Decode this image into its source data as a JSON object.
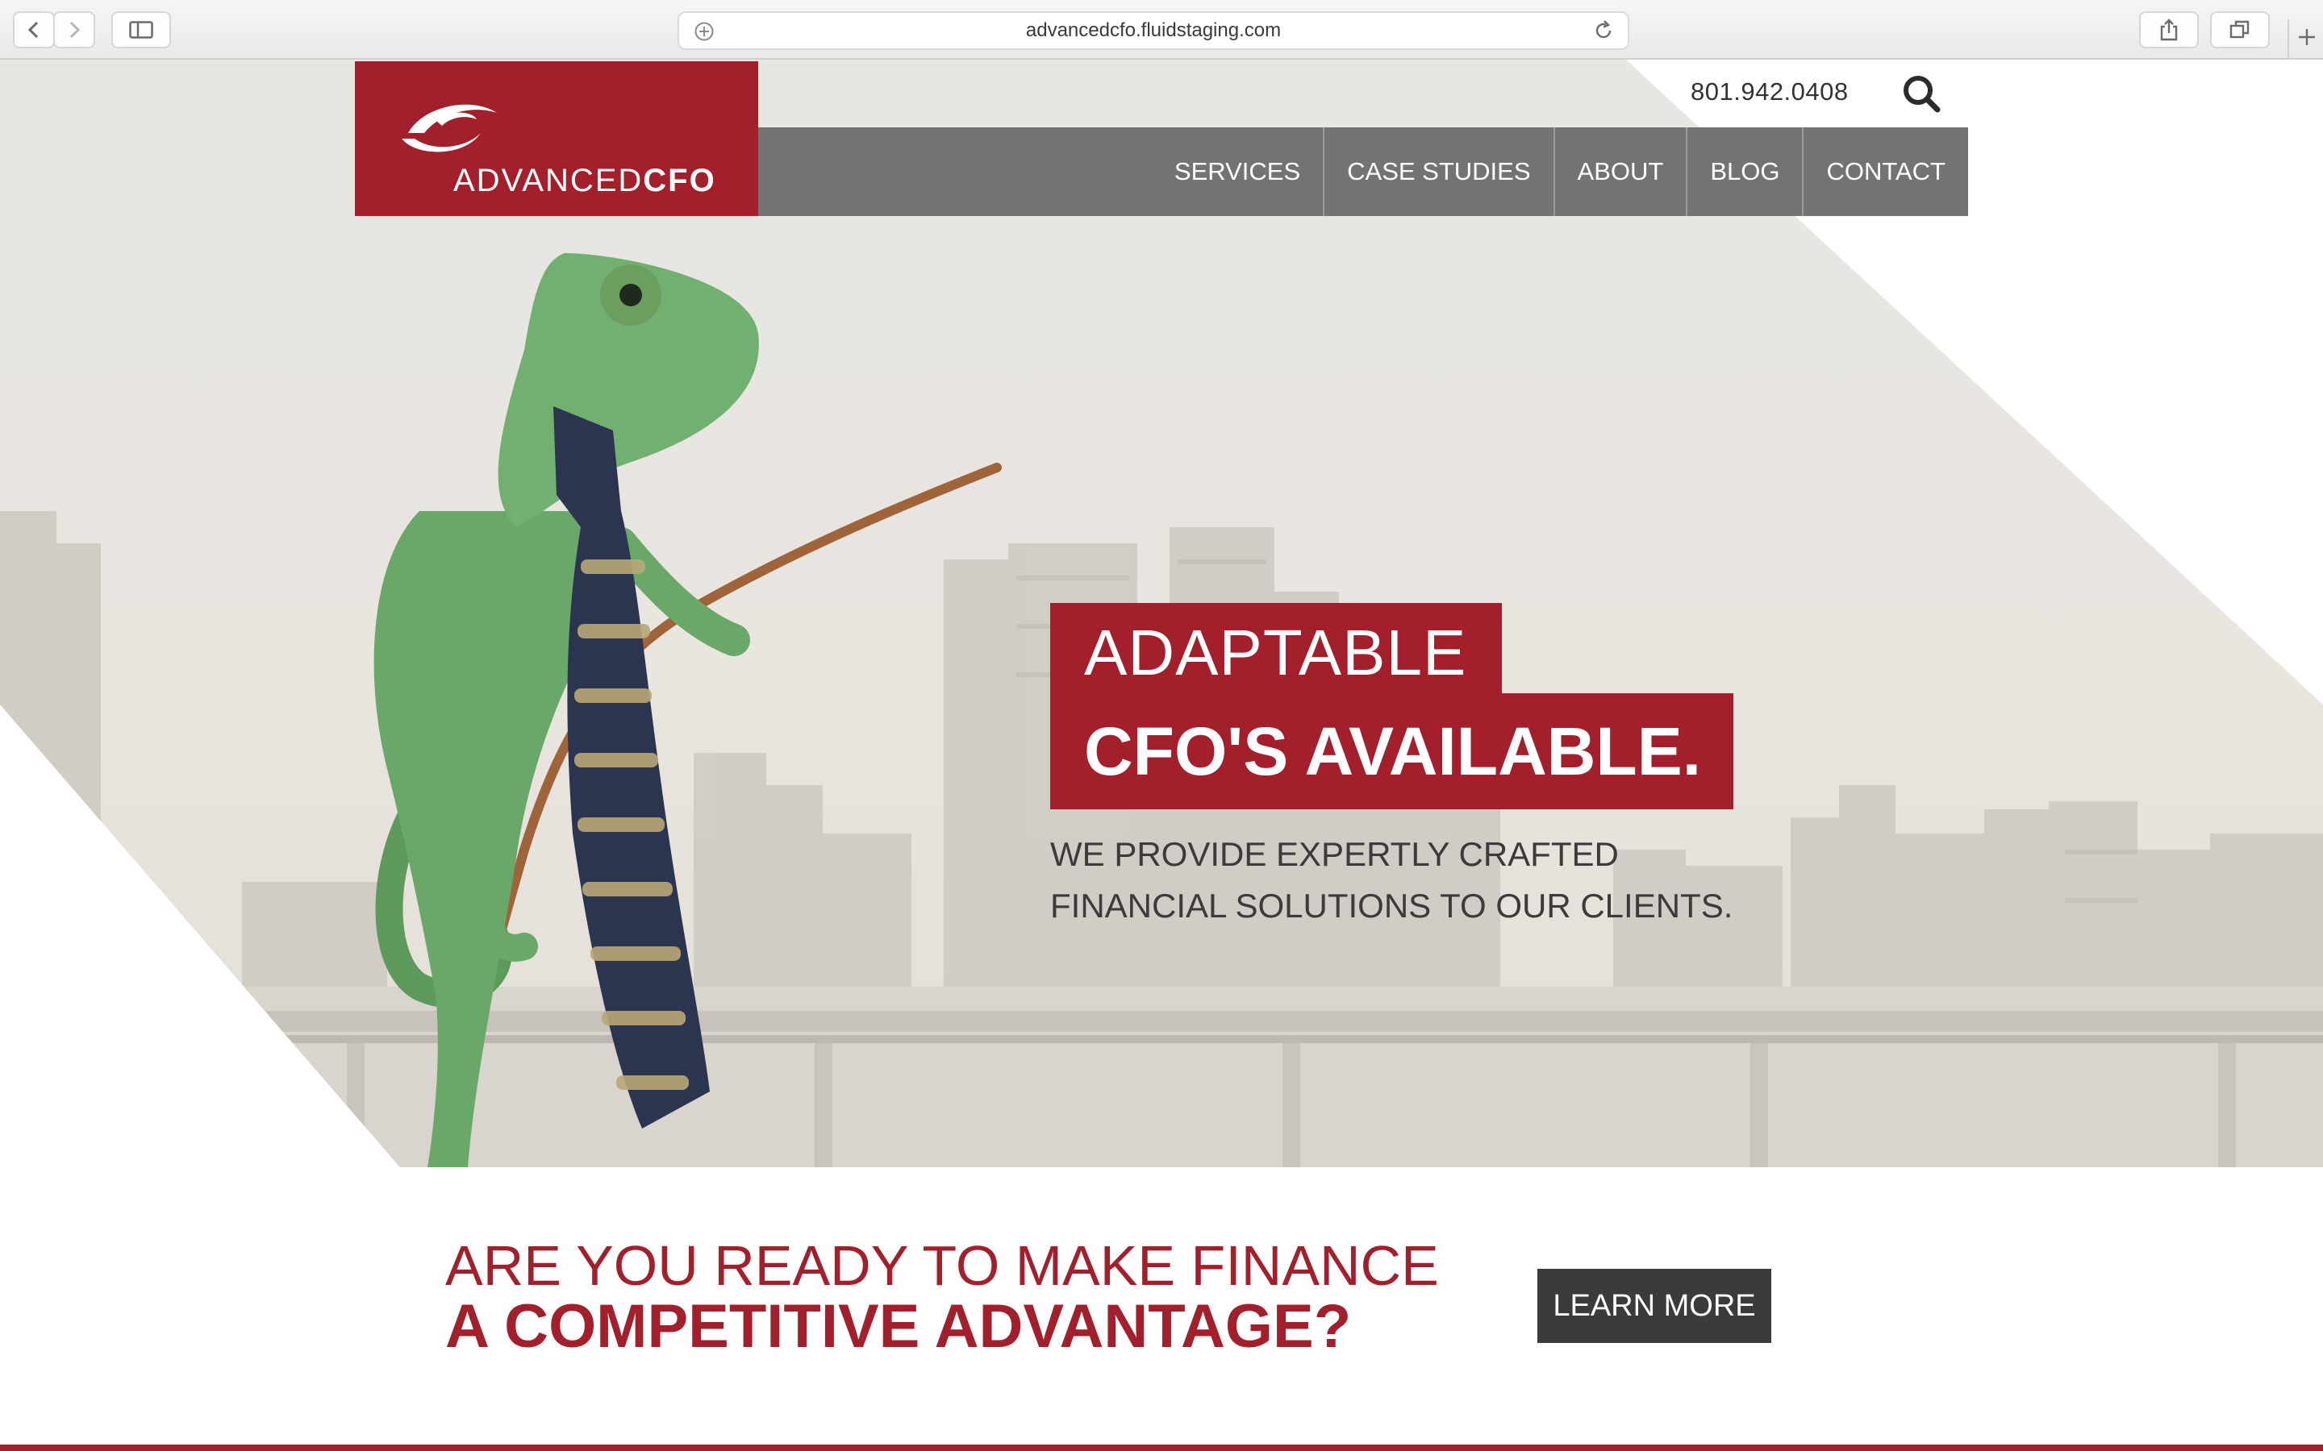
{
  "browser": {
    "url": "advancedcfo.fluidstaging.com"
  },
  "logo": {
    "text_light": "ADVANCED",
    "text_bold": "CFO"
  },
  "header": {
    "phone": "801.942.0408"
  },
  "nav": {
    "items": [
      {
        "label": "SERVICES"
      },
      {
        "label": "CASE STUDIES"
      },
      {
        "label": "ABOUT"
      },
      {
        "label": "BLOG"
      },
      {
        "label": "CONTACT"
      }
    ]
  },
  "hero": {
    "headline_1": "ADAPTABLE",
    "headline_2": "CFO'S AVAILABLE.",
    "subtext_line_1": "WE PROVIDE EXPERTLY CRAFTED",
    "subtext_line_2": "FINANCIAL SOLUTIONS TO OUR CLIENTS."
  },
  "cta": {
    "line_1": "ARE YOU READY TO MAKE FINANCE",
    "line_2": "A COMPETITIVE ADVANTAGE?",
    "button": "LEARN MORE"
  },
  "colors": {
    "brand_red": "#a31f2b",
    "nav_gray": "#737373",
    "button_dark": "#3b3b3b"
  },
  "icons": [
    "back-icon",
    "forward-icon",
    "sidebar-icon",
    "add-icon",
    "reload-icon",
    "share-icon",
    "tabs-icon",
    "new-tab-icon",
    "search-icon",
    "logo-swirl-icon"
  ]
}
